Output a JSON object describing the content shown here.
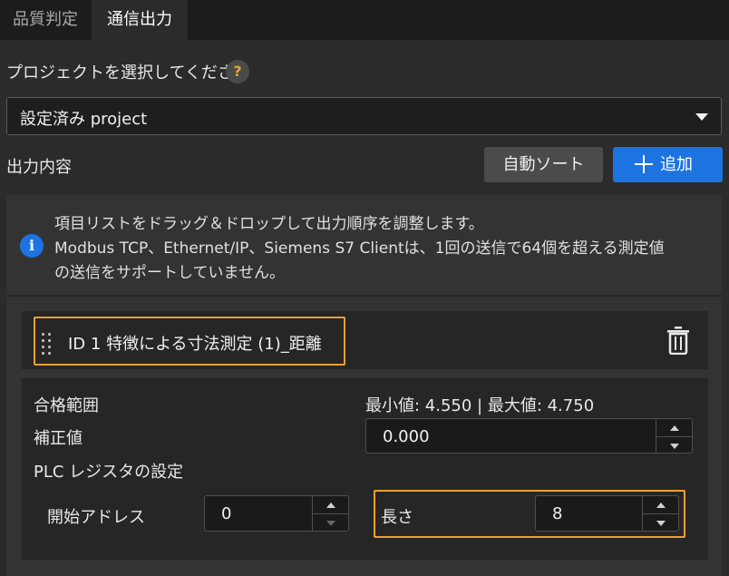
{
  "tabs": [
    {
      "label": "品質判定",
      "active": false
    },
    {
      "label": "通信出力",
      "active": true
    }
  ],
  "project": {
    "label": "プロジェクトを選択してください",
    "help_icon": "?",
    "selected": "設定済み project"
  },
  "output": {
    "label": "出力内容",
    "sort_button": "自動ソート",
    "add_button": "追加"
  },
  "info": {
    "icon": "i",
    "lines": [
      "項目リストをドラッグ＆ドロップして出力順序を調整します。",
      "Modbus TCP、Ethernet/IP、Siemens S7 Clientは、1回の送信で64個を超える測定値",
      "の送信をサポートしていません。"
    ]
  },
  "item": {
    "title": "ID 1  特徴による寸法測定 (1)_距離",
    "pass_range_label": "合格範囲",
    "pass_range_value": "最小値: 4.550 | 最大値: 4.750",
    "correction_label": "補正値",
    "correction_value": "0.000",
    "plc_label": "PLC レジスタの設定",
    "start_address_label": "開始アドレス",
    "start_address_value": "0",
    "length_label": "長さ",
    "length_value": "8"
  },
  "colors": {
    "accent": "#1d74e0",
    "highlight": "#f0a030",
    "help": "#e3a92d"
  }
}
